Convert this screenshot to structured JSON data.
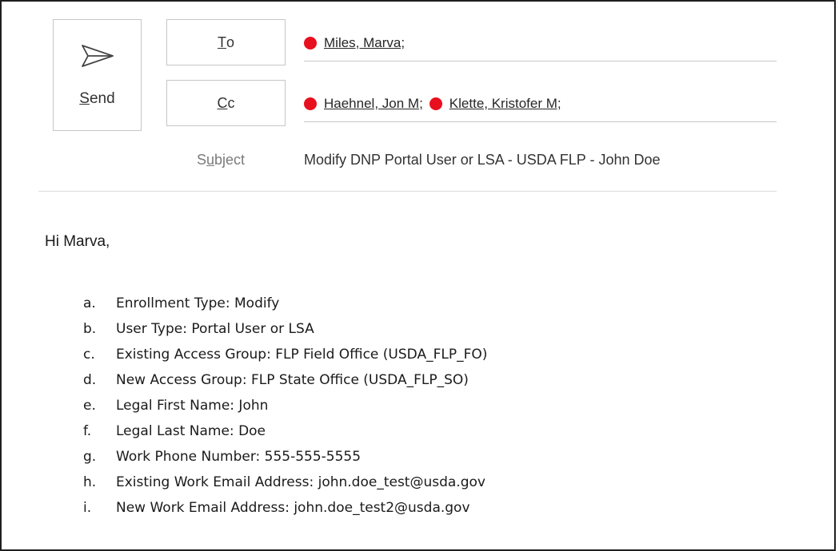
{
  "send": {
    "label": "Send",
    "mnemonic": "S",
    "rest": "end",
    "icon": "send-icon"
  },
  "to": {
    "button_mnemonic": "T",
    "button_rest": "o",
    "recipients": [
      {
        "name": "Miles, Marva;",
        "status_color": "#e8101e"
      }
    ]
  },
  "cc": {
    "button_mnemonic": "C",
    "button_rest": "c",
    "recipients": [
      {
        "name": "Haehnel, Jon M;",
        "status_color": "#e8101e"
      },
      {
        "name": "Klette, Kristofer M;",
        "status_color": "#e8101e"
      }
    ]
  },
  "subject": {
    "label_pre": "S",
    "label_mnemonic": "u",
    "label_post": "bject",
    "value": "Modify DNP Portal User or LSA - USDA FLP - John Doe"
  },
  "body": {
    "greeting": "Hi Marva,",
    "items": [
      {
        "marker": "a.",
        "text": "Enrollment Type: Modify"
      },
      {
        "marker": "b.",
        "text": "User Type: Portal User or LSA"
      },
      {
        "marker": "c.",
        "text": "Existing Access Group: FLP Field Office (USDA_FLP_FO)"
      },
      {
        "marker": "d.",
        "text": "New Access Group: FLP State Office (USDA_FLP_SO)"
      },
      {
        "marker": "e.",
        "text": "Legal First Name: John"
      },
      {
        "marker": "f.",
        "text": "Legal Last Name: Doe"
      },
      {
        "marker": "g.",
        "text": "Work Phone Number: 555-555-5555"
      },
      {
        "marker": "h.",
        "text": "Existing Work Email Address: john.doe_test@usda.gov"
      },
      {
        "marker": "i.",
        "text": "New Work Email Address: john.doe_test2@usda.gov"
      }
    ]
  }
}
